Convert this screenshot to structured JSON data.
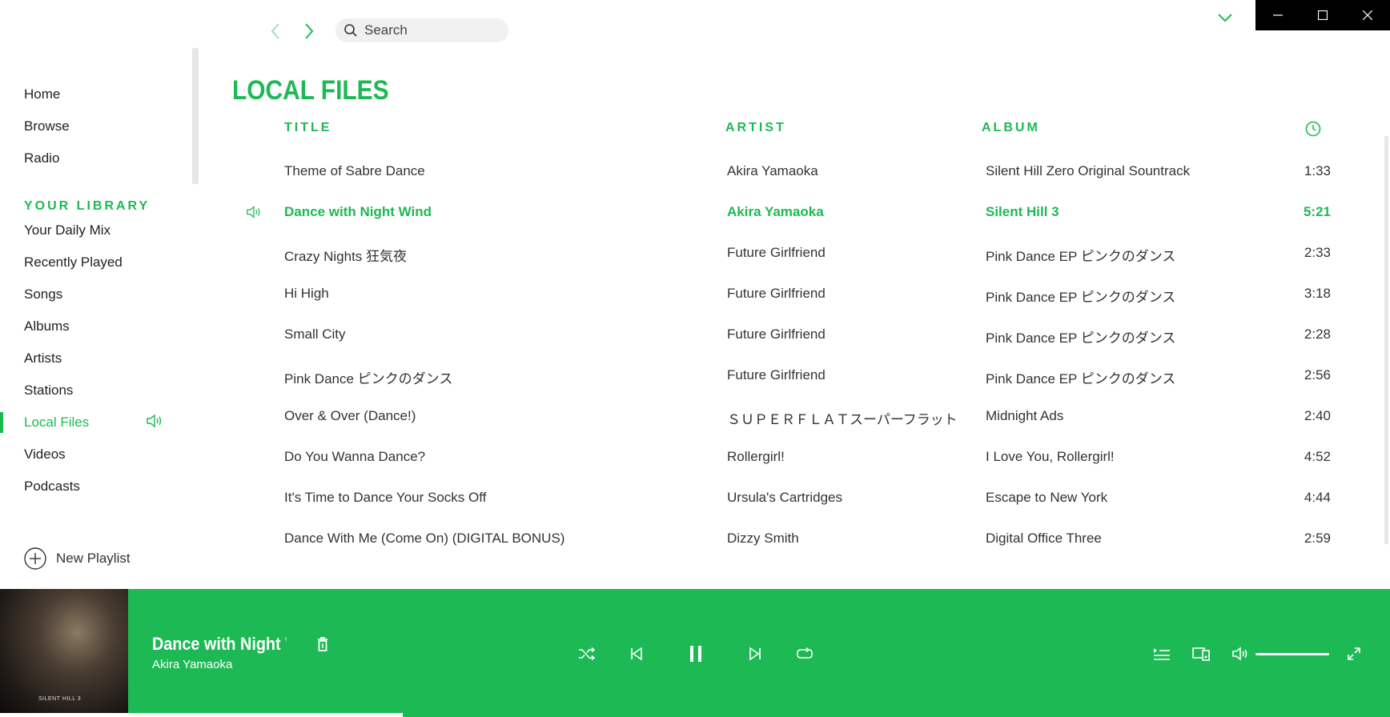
{
  "search": {
    "placeholder": "Search"
  },
  "sidebar": {
    "main_items": [
      {
        "label": "Home"
      },
      {
        "label": "Browse"
      },
      {
        "label": "Radio"
      }
    ],
    "library_heading": "YOUR LIBRARY",
    "library_items": [
      {
        "label": "Your Daily Mix"
      },
      {
        "label": "Recently Played"
      },
      {
        "label": "Songs"
      },
      {
        "label": "Albums"
      },
      {
        "label": "Artists"
      },
      {
        "label": "Stations"
      },
      {
        "label": "Local Files",
        "active": true
      },
      {
        "label": "Videos"
      },
      {
        "label": "Podcasts"
      }
    ],
    "new_playlist_label": "New Playlist"
  },
  "main": {
    "title": "LOCAL FILES",
    "columns": {
      "title": "TITLE",
      "artist": "ARTIST",
      "album": "ALBUM",
      "duration_icon": "clock-icon"
    },
    "tracks": [
      {
        "title": "Theme of Sabre Dance",
        "artist": "Akira Yamaoka",
        "album": "Silent Hill Zero Original Sountrack",
        "duration": "1:33"
      },
      {
        "title": "Dance with Night Wind",
        "artist": "Akira Yamaoka",
        "album": "Silent Hill 3",
        "duration": "5:21",
        "playing": true
      },
      {
        "title": "Crazy Nights 狂気夜",
        "artist": "Future Girlfriend",
        "album": "Pink Dance EP ピンクのダンス",
        "duration": "2:33"
      },
      {
        "title": "Hi High",
        "artist": "Future Girlfriend",
        "album": "Pink Dance EP ピンクのダンス",
        "duration": "3:18"
      },
      {
        "title": "Small City",
        "artist": "Future Girlfriend",
        "album": "Pink Dance EP ピンクのダンス",
        "duration": "2:28"
      },
      {
        "title": "Pink Dance ピンクのダンス",
        "artist": "Future Girlfriend",
        "album": "Pink Dance EP ピンクのダンス",
        "duration": "2:56"
      },
      {
        "title": "Over & Over (Dance!)",
        "artist": "ＳＵＰＥＲＦＬＡＴスーパーフラット",
        "album": "Midnight Ads",
        "duration": "2:40"
      },
      {
        "title": "Do You Wanna Dance?",
        "artist": "Rollergirl!",
        "album": "I Love You, Rollergirl!",
        "duration": "4:52"
      },
      {
        "title": "It's Time to Dance Your Socks Off",
        "artist": "Ursula's Cartridges",
        "album": "Escape to New York",
        "duration": "4:44"
      },
      {
        "title": "Dance With Me (Come On) (DIGITAL BONUS)",
        "artist": "Dizzy Smith",
        "album": "Digital Office Three",
        "duration": "2:59"
      }
    ]
  },
  "player": {
    "track_name": "Dance with Night Wind",
    "artist": "Akira Yamaoka",
    "cover_text": "SILENT HILL 3",
    "progress": 0.29,
    "volume": 1.0
  },
  "colors": {
    "accent": "#1db954",
    "window_controls_bg": "#000000"
  }
}
